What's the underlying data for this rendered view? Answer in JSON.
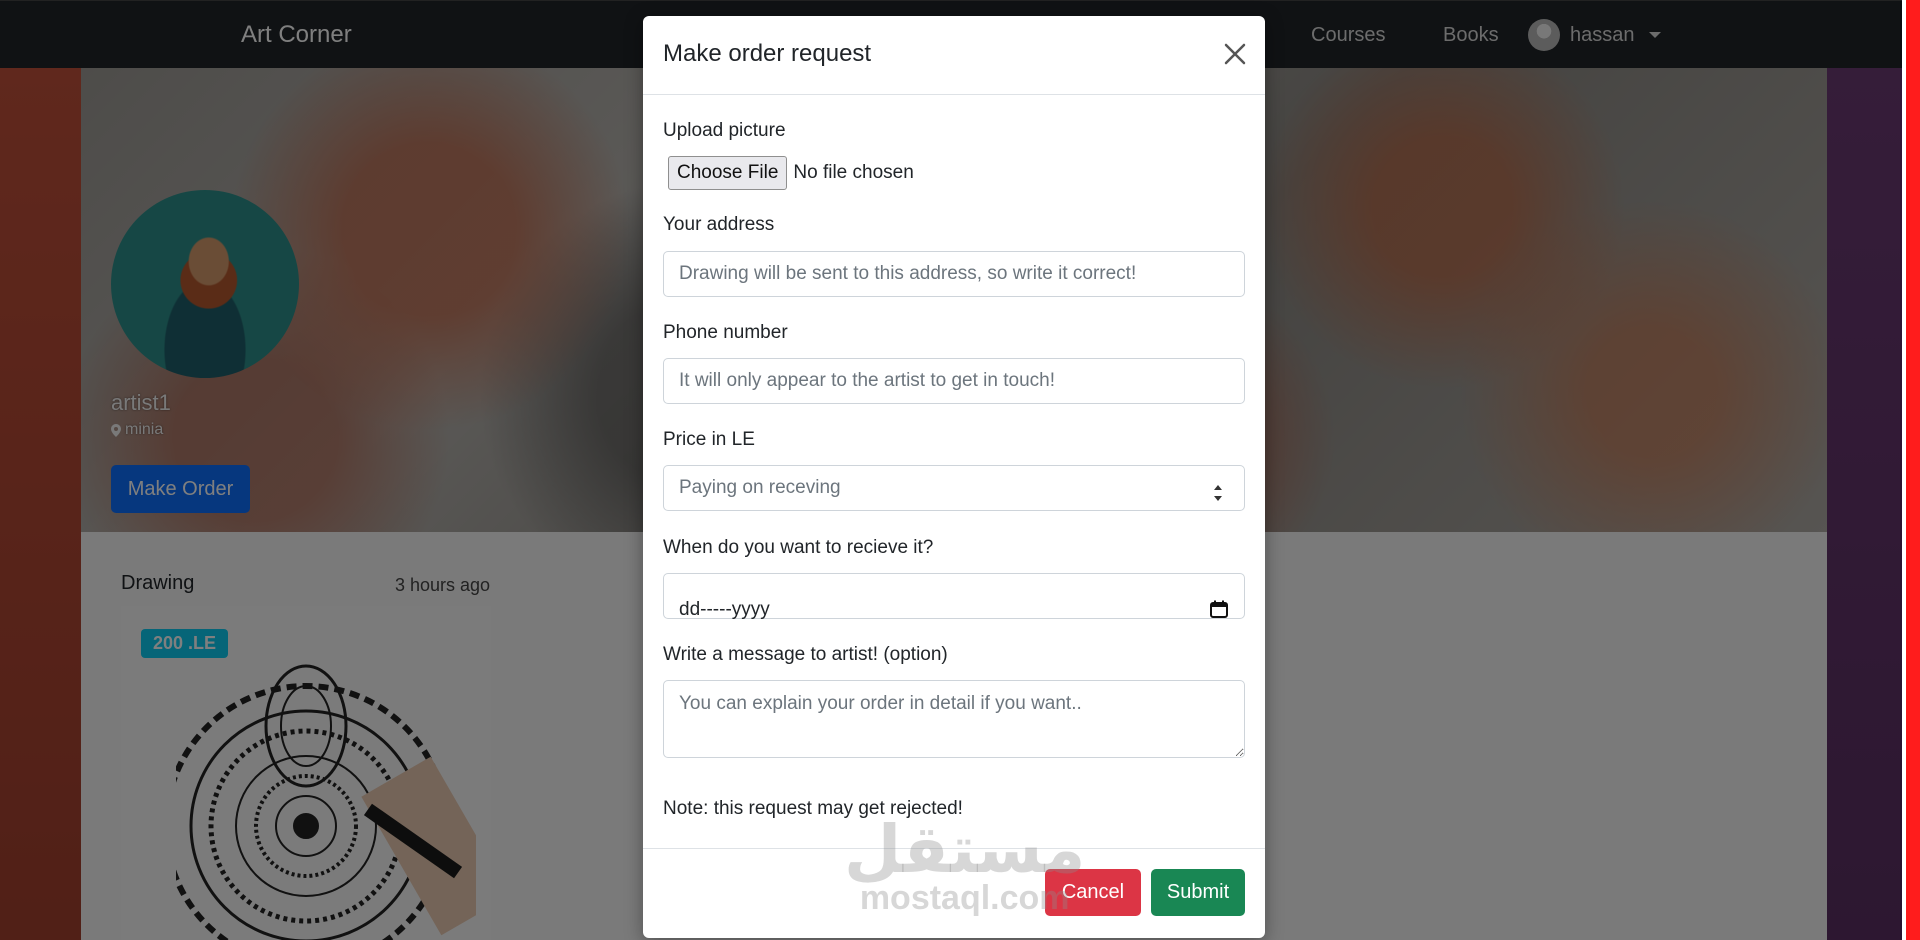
{
  "navbar": {
    "brand": "Art Corner",
    "links": [
      "Courses",
      "Books"
    ],
    "user_name": "hassan"
  },
  "profile": {
    "name": "artist1",
    "location": "minia",
    "make_order_label": "Make Order"
  },
  "post": {
    "category": "Drawing",
    "time": "3 hours ago",
    "price": "200 .LE"
  },
  "modal": {
    "title": "Make order request",
    "upload_label": "Upload picture",
    "file_button": "Choose File",
    "file_status": "No file chosen",
    "address_label": "Your address",
    "address_placeholder": "Drawing will be sent to this address, so write it correct!",
    "phone_label": "Phone number",
    "phone_placeholder": "It will only appear to the artist to get in touch!",
    "price_label": "Price in LE",
    "price_placeholder": "Paying on receving",
    "date_label": "When do you want to recieve it?",
    "date_value": "dd-----yyyy",
    "message_label": "Write a message to artist! (option)",
    "message_placeholder": "You can explain your order in detail if you want..",
    "note": "Note: this request may get rejected!",
    "cancel_label": "Cancel",
    "submit_label": "Submit"
  },
  "watermark": {
    "arabic": "مستقل",
    "latin": "mostaql.com"
  },
  "colors": {
    "navbar": "#212529",
    "primary": "#0d6efd",
    "danger": "#dc3545",
    "success": "#198754",
    "info": "#0dcaf0"
  }
}
